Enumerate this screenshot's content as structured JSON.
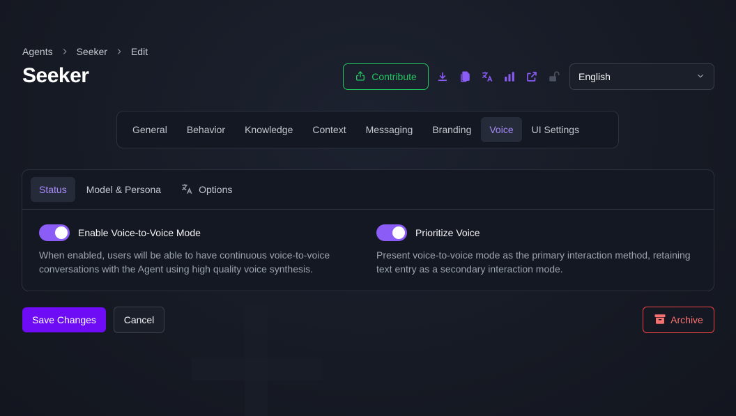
{
  "breadcrumb": [
    "Agents",
    "Seeker",
    "Edit"
  ],
  "page": {
    "title": "Seeker"
  },
  "header": {
    "contribute_label": "Contribute",
    "icons": [
      "download-icon",
      "copy-icon",
      "translate-icon",
      "bar-chart-icon",
      "external-link-icon",
      "unlock-icon"
    ],
    "language": "English"
  },
  "tabs": [
    {
      "label": "General"
    },
    {
      "label": "Behavior"
    },
    {
      "label": "Knowledge"
    },
    {
      "label": "Context"
    },
    {
      "label": "Messaging"
    },
    {
      "label": "Branding"
    },
    {
      "label": "Voice",
      "active": true
    },
    {
      "label": "UI Settings"
    }
  ],
  "subtabs": [
    {
      "label": "Status",
      "active": true
    },
    {
      "label": "Model & Persona"
    },
    {
      "label": "Options",
      "icon": "translate-icon"
    }
  ],
  "settings": [
    {
      "title": "Enable Voice-to-Voice Mode",
      "enabled": true,
      "description": "When enabled, users will be able to have continuous voice-to-voice conversations with the Agent using high quality voice synthesis."
    },
    {
      "title": "Prioritize Voice",
      "enabled": true,
      "description": "Present voice-to-voice mode as the primary interaction method, retaining text entry as a secondary interaction mode."
    }
  ],
  "footer": {
    "save_label": "Save Changes",
    "cancel_label": "Cancel",
    "archive_label": "Archive"
  },
  "colors": {
    "accent": "#8b5cf6",
    "contribute": "#22c55e",
    "save": "#6d0cf5",
    "archive": "#ef4444"
  }
}
